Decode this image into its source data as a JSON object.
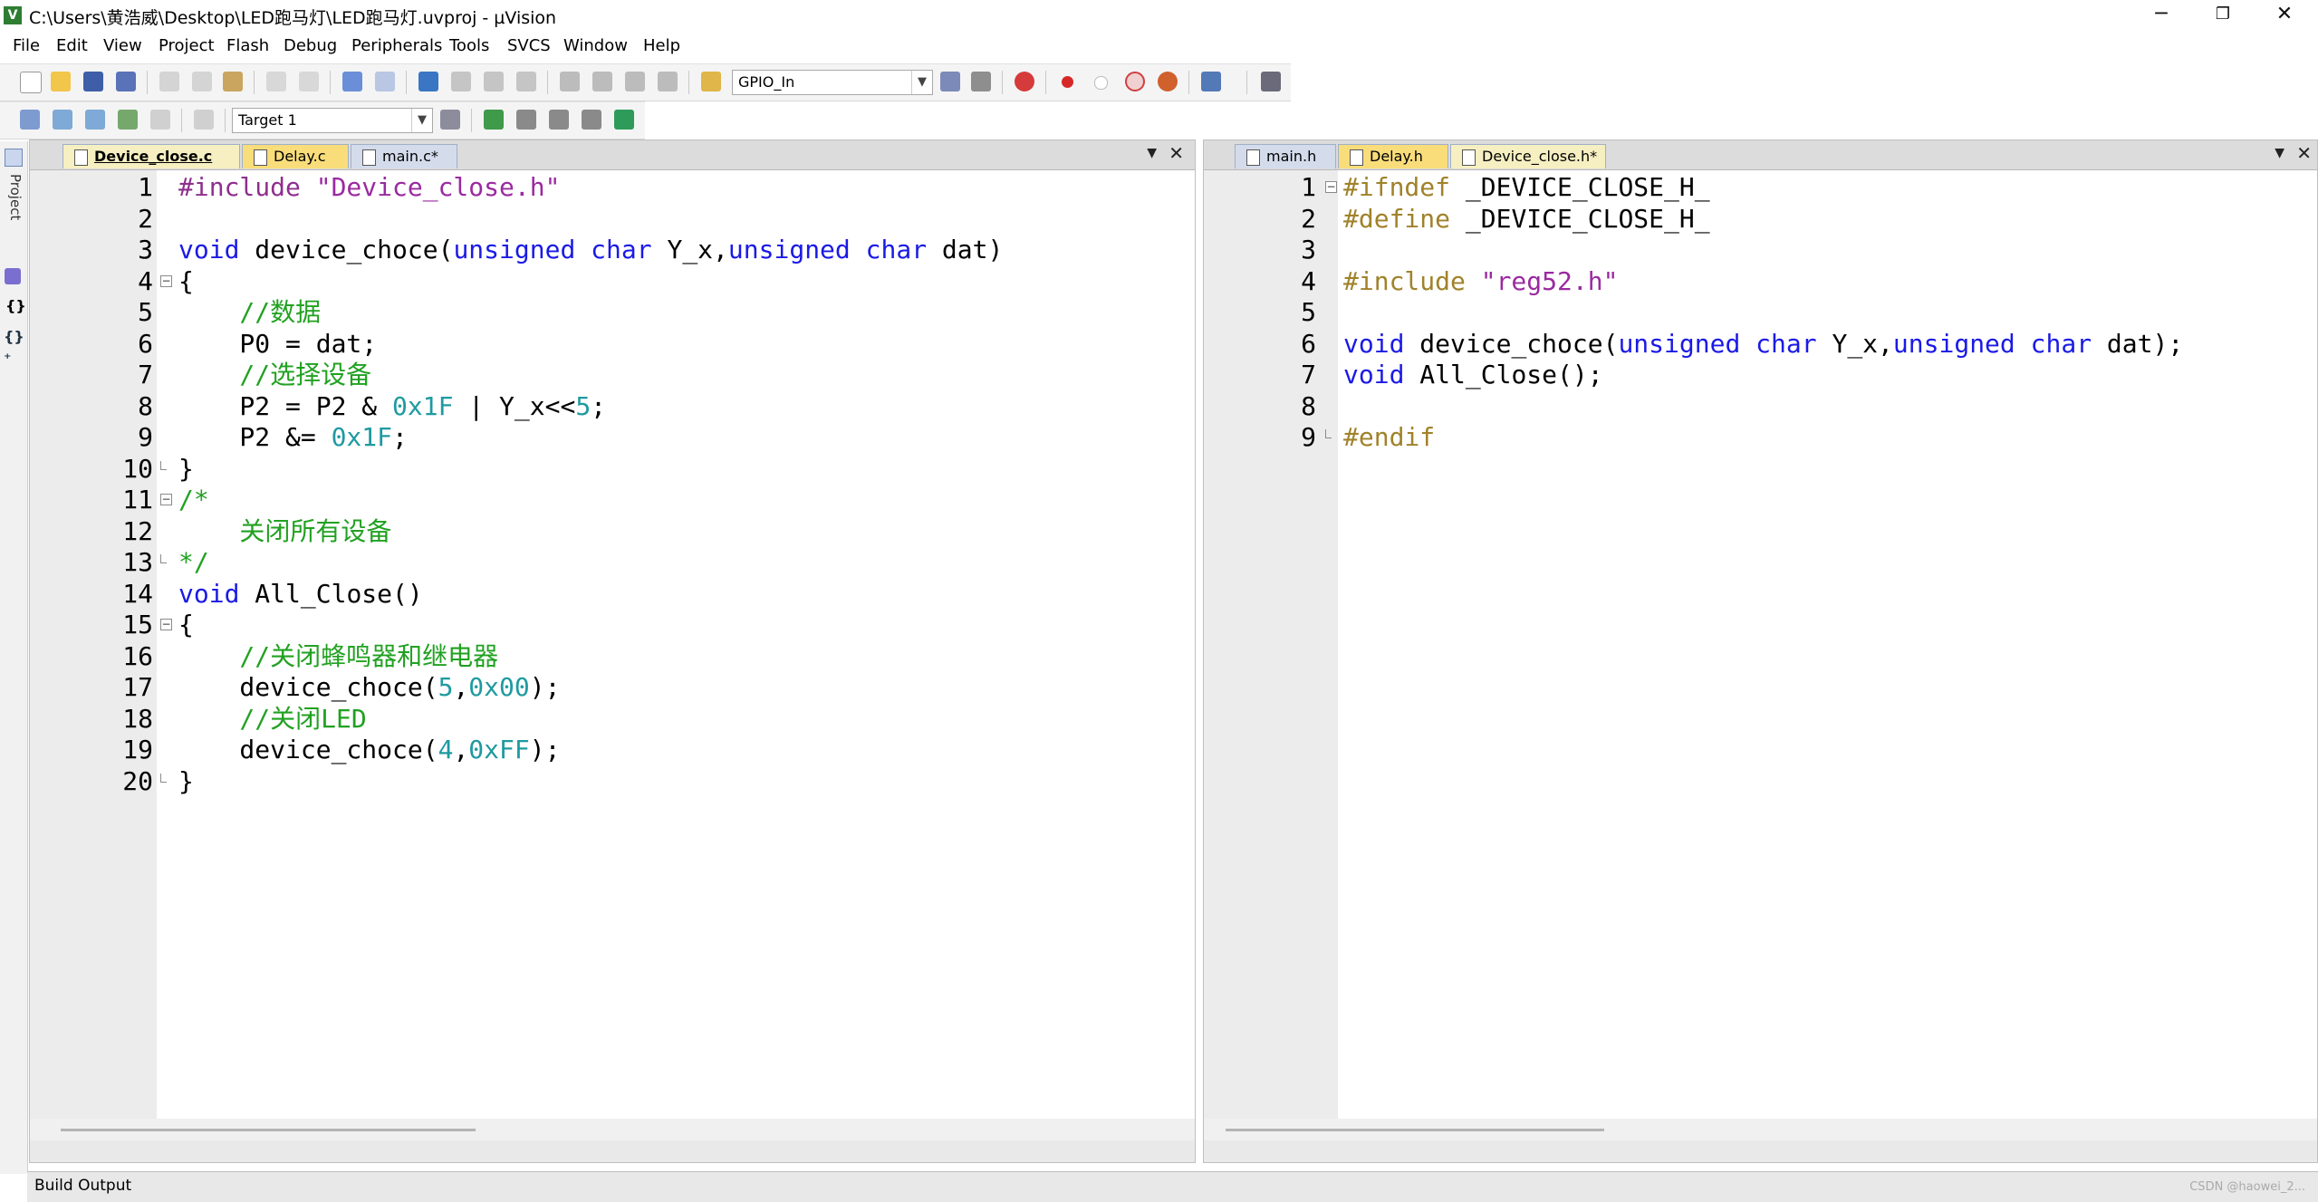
{
  "window": {
    "title": "C:\\Users\\黄浩威\\Desktop\\LED跑马灯\\LED跑马灯.uvproj - µVision",
    "app_icon": "V",
    "controls": {
      "minimize": "─",
      "restore": "❐",
      "close": "✕"
    }
  },
  "menu": [
    "File",
    "Edit",
    "View",
    "Project",
    "Flash",
    "Debug",
    "Peripherals",
    "Tools",
    "SVCS",
    "Window",
    "Help"
  ],
  "toolbar": {
    "find_combo": "GPIO_In",
    "target_combo": "Target 1",
    "icons": [
      "new-file",
      "open-file",
      "save",
      "save-all",
      "cut",
      "copy",
      "paste",
      "undo",
      "redo",
      "nav-back",
      "nav-forward",
      "bookmark",
      "prev-bookmark",
      "next-bookmark",
      "clear-bookmarks",
      "indent",
      "unindent",
      "comment",
      "uncomment",
      "find-in-files",
      "find",
      "incremental-find",
      "debug",
      "breakpoint",
      "disable-breakpoint",
      "kill-breakpoints",
      "clear-breakpoints",
      "window-layout",
      "configure"
    ],
    "build_icons": [
      "translate",
      "build",
      "rebuild",
      "batch-build",
      "stop-build",
      "download",
      "target-options",
      "file-extensions",
      "manage-components",
      "select-packs",
      "run-time-environment"
    ]
  },
  "side": {
    "project_label": "Project",
    "braces": "{}",
    "func": "{}₊"
  },
  "left_pane": {
    "tabs": [
      {
        "label": "Device_close.c",
        "kind": "c",
        "active": true
      },
      {
        "label": "Delay.c",
        "kind": "y",
        "active": false
      },
      {
        "label": "main.c*",
        "kind": "h",
        "active": false
      }
    ],
    "menu_arrow": "▼",
    "close": "✕",
    "highlight_line": 3,
    "lines": [
      {
        "n": "1",
        "fold": "",
        "tokens": [
          {
            "t": "#include ",
            "c": "pp"
          },
          {
            "t": "\"Device_close.h\"",
            "c": "str"
          }
        ]
      },
      {
        "n": "2",
        "fold": "",
        "tokens": []
      },
      {
        "n": "3",
        "fold": "",
        "tokens": [
          {
            "t": "void",
            "c": "kw"
          },
          {
            "t": " device_choce(",
            "c": ""
          },
          {
            "t": "unsigned char",
            "c": "kw"
          },
          {
            "t": " Y_x,",
            "c": ""
          },
          {
            "t": "unsigned char",
            "c": "kw"
          },
          {
            "t": " dat)",
            "c": ""
          }
        ]
      },
      {
        "n": "4",
        "fold": "open",
        "tokens": [
          {
            "t": "{",
            "c": ""
          }
        ]
      },
      {
        "n": "5",
        "fold": "",
        "tokens": [
          {
            "t": "    //数据",
            "c": "cm"
          }
        ]
      },
      {
        "n": "6",
        "fold": "",
        "tokens": [
          {
            "t": "    P0 = dat;",
            "c": ""
          }
        ]
      },
      {
        "n": "7",
        "fold": "",
        "tokens": [
          {
            "t": "    //选择设备",
            "c": "cm"
          }
        ]
      },
      {
        "n": "8",
        "fold": "",
        "tokens": [
          {
            "t": "    P2 = P2 & ",
            "c": ""
          },
          {
            "t": "0x1F",
            "c": "numc"
          },
          {
            "t": " | Y_x<<",
            "c": ""
          },
          {
            "t": "5",
            "c": "numc"
          },
          {
            "t": ";",
            "c": ""
          }
        ]
      },
      {
        "n": "9",
        "fold": "",
        "tokens": [
          {
            "t": "    P2 &= ",
            "c": ""
          },
          {
            "t": "0x1F",
            "c": "numc"
          },
          {
            "t": ";",
            "c": ""
          }
        ]
      },
      {
        "n": "10",
        "fold": "end",
        "tokens": [
          {
            "t": "}",
            "c": ""
          }
        ]
      },
      {
        "n": "11",
        "fold": "open",
        "tokens": [
          {
            "t": "/*",
            "c": "cm"
          }
        ]
      },
      {
        "n": "12",
        "fold": "",
        "tokens": [
          {
            "t": "    关闭所有设备",
            "c": "cm"
          }
        ]
      },
      {
        "n": "13",
        "fold": "end",
        "tokens": [
          {
            "t": "*/",
            "c": "cm"
          }
        ]
      },
      {
        "n": "14",
        "fold": "",
        "tokens": [
          {
            "t": "void",
            "c": "kw"
          },
          {
            "t": " All_Close()",
            "c": ""
          }
        ]
      },
      {
        "n": "15",
        "fold": "open",
        "tokens": [
          {
            "t": "{",
            "c": ""
          }
        ]
      },
      {
        "n": "16",
        "fold": "",
        "tokens": [
          {
            "t": "    //关闭蜂鸣器和继电器",
            "c": "cm"
          }
        ]
      },
      {
        "n": "17",
        "fold": "",
        "tokens": [
          {
            "t": "    device_choce(",
            "c": ""
          },
          {
            "t": "5",
            "c": "numc"
          },
          {
            "t": ",",
            "c": ""
          },
          {
            "t": "0x00",
            "c": "numc"
          },
          {
            "t": ");",
            "c": ""
          }
        ]
      },
      {
        "n": "18",
        "fold": "",
        "tokens": [
          {
            "t": "    //关闭LED",
            "c": "cm"
          }
        ]
      },
      {
        "n": "19",
        "fold": "",
        "tokens": [
          {
            "t": "    device_choce(",
            "c": ""
          },
          {
            "t": "4",
            "c": "numc"
          },
          {
            "t": ",",
            "c": ""
          },
          {
            "t": "0xFF",
            "c": "numc"
          },
          {
            "t": ");",
            "c": ""
          }
        ]
      },
      {
        "n": "20",
        "fold": "end",
        "tokens": [
          {
            "t": "}",
            "c": ""
          }
        ]
      }
    ]
  },
  "right_pane": {
    "tabs": [
      {
        "label": "main.h",
        "kind": "h",
        "active": false
      },
      {
        "label": "Delay.h",
        "kind": "y",
        "active": false
      },
      {
        "label": "Device_close.h*",
        "kind": "c",
        "active": false
      }
    ],
    "menu_arrow": "▼",
    "close": "✕",
    "highlight_line": 0,
    "lines": [
      {
        "n": "1",
        "fold": "open",
        "tokens": [
          {
            "t": "#ifndef",
            "c": "ppr"
          },
          {
            "t": " _DEVICE_CLOSE_H_",
            "c": ""
          }
        ]
      },
      {
        "n": "2",
        "fold": "",
        "tokens": [
          {
            "t": "#define",
            "c": "ppr"
          },
          {
            "t": " _DEVICE_CLOSE_H_",
            "c": ""
          }
        ]
      },
      {
        "n": "3",
        "fold": "",
        "tokens": []
      },
      {
        "n": "4",
        "fold": "",
        "tokens": [
          {
            "t": "#include ",
            "c": "ppr"
          },
          {
            "t": "\"reg52.h\"",
            "c": "str"
          }
        ]
      },
      {
        "n": "5",
        "fold": "",
        "tokens": []
      },
      {
        "n": "6",
        "fold": "",
        "tokens": [
          {
            "t": "void",
            "c": "kw"
          },
          {
            "t": " device_choce(",
            "c": ""
          },
          {
            "t": "unsigned char",
            "c": "kw"
          },
          {
            "t": " Y_x,",
            "c": ""
          },
          {
            "t": "unsigned char",
            "c": "kw"
          },
          {
            "t": " dat);",
            "c": ""
          }
        ]
      },
      {
        "n": "7",
        "fold": "",
        "tokens": [
          {
            "t": "void",
            "c": "kw"
          },
          {
            "t": " All_Close();",
            "c": ""
          }
        ]
      },
      {
        "n": "8",
        "fold": "",
        "tokens": []
      },
      {
        "n": "9",
        "fold": "end",
        "tokens": [
          {
            "t": "#endif",
            "c": "ppr"
          }
        ]
      }
    ]
  },
  "build_output": {
    "label": "Build Output",
    "watermark": "CSDN @haowei_2..."
  },
  "colors": {
    "keyword": "#1a1ae6",
    "comment": "#21a121",
    "string": "#9a2aa0",
    "number": "#1e9aa0",
    "preproc": "#8e2f8e",
    "highlight": "#e6f9e6"
  }
}
